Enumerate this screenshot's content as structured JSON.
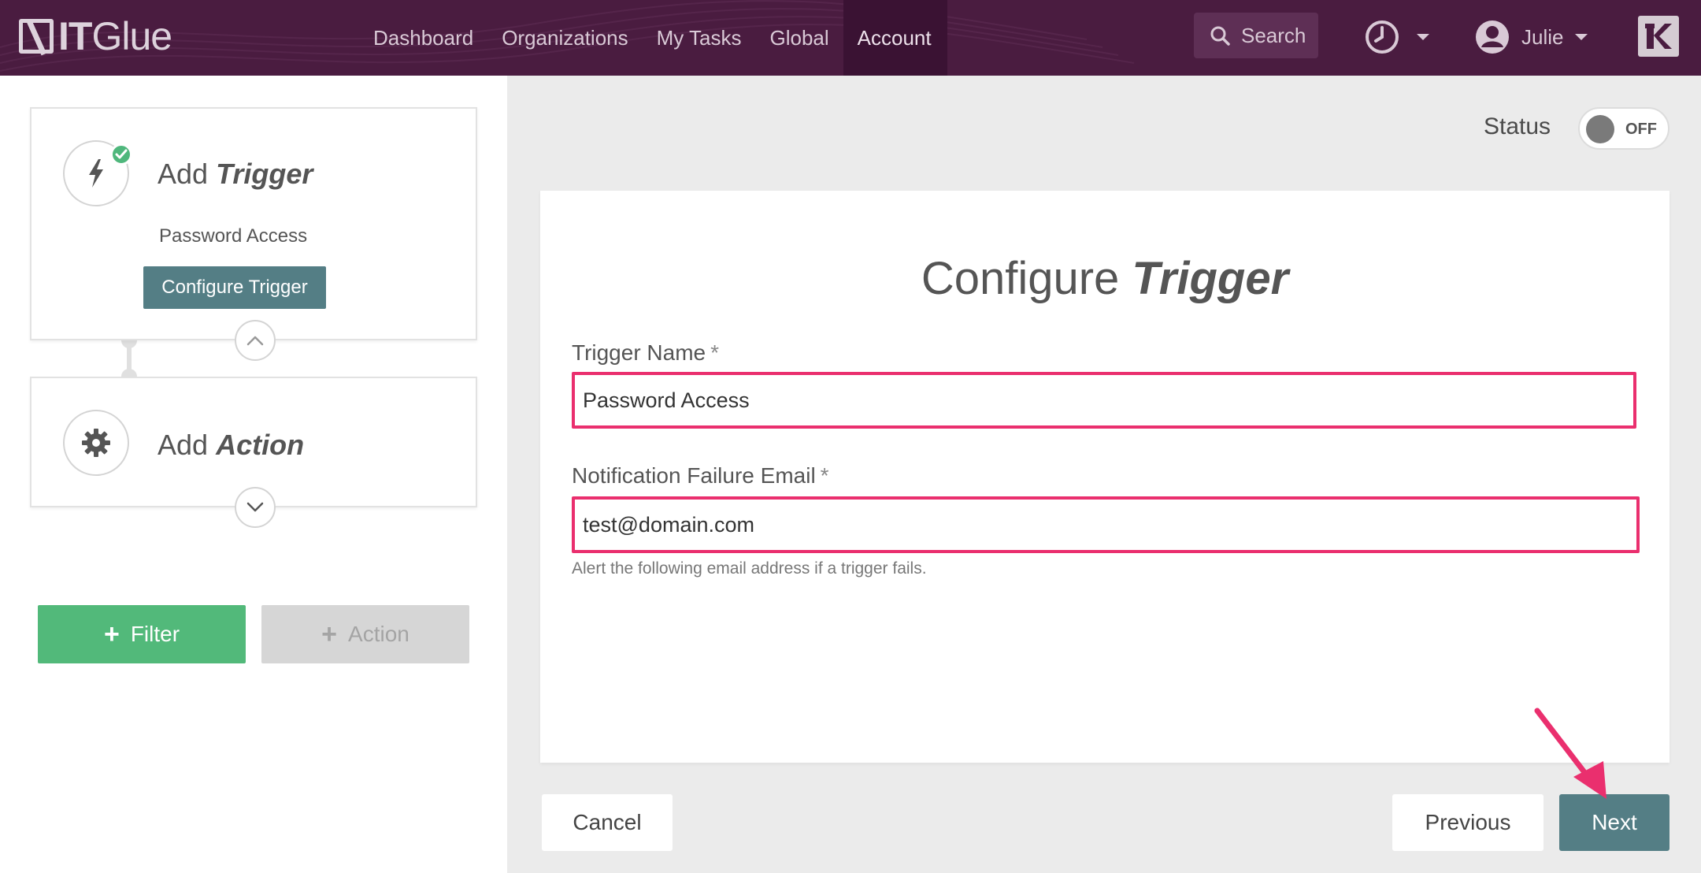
{
  "navbar": {
    "logo_text_bold": "IT",
    "logo_text": "Glue",
    "links": [
      {
        "label": "Dashboard"
      },
      {
        "label": "Organizations"
      },
      {
        "label": "My Tasks"
      },
      {
        "label": "Global"
      },
      {
        "label": "Account",
        "active": true
      }
    ],
    "search_label": "Search",
    "user_name": "Julie",
    "icons": [
      "search-icon",
      "clock-icon",
      "user-icon",
      "caret-down-icon",
      "kaseya-logo"
    ]
  },
  "steps": {
    "trigger": {
      "title_prefix": "Add",
      "title_emph": "Trigger",
      "subtitle": "Password Access",
      "button": "Configure Trigger",
      "completed": true
    },
    "action": {
      "title_prefix": "Add",
      "title_emph": "Action"
    }
  },
  "buttons": {
    "filter": "Filter",
    "action": "Action",
    "cancel": "Cancel",
    "previous": "Previous",
    "next": "Next"
  },
  "status": {
    "label": "Status",
    "toggle_text": "OFF",
    "enabled": false
  },
  "form": {
    "title_prefix": "Configure",
    "title_emph": "Trigger",
    "trigger_name_label": "Trigger Name",
    "trigger_name_value": "Password Access",
    "email_label": "Notification Failure Email",
    "email_value": "test@domain.com",
    "email_help": "Alert the following email address if a trigger fails.",
    "required_mark": "*"
  },
  "colors": {
    "navbar_bg": "#4a1c40",
    "accent_teal": "#547e85",
    "filter_green": "#52b97a",
    "highlight_pink": "#ea2f6e",
    "check_green": "#4fb77c"
  }
}
